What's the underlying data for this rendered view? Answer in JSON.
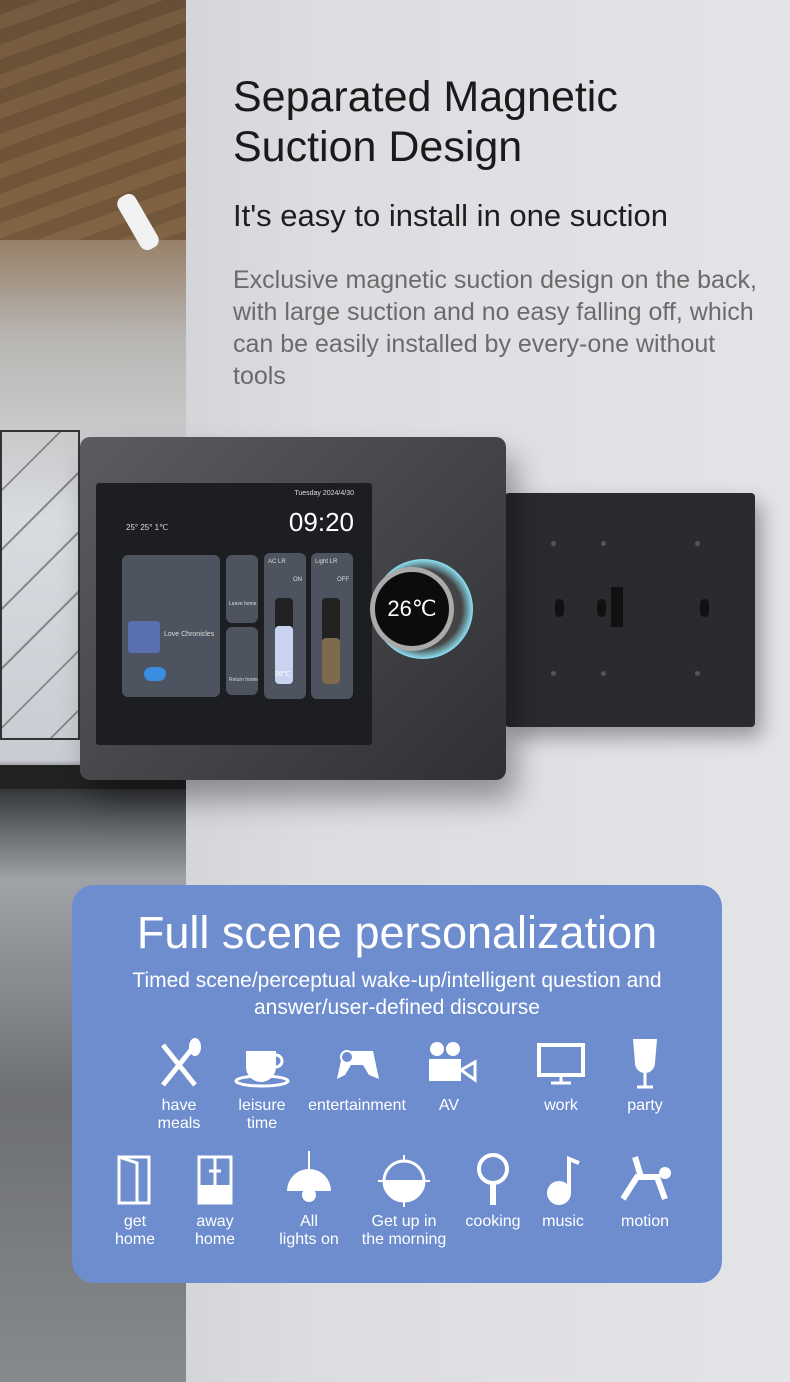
{
  "header": {
    "title_line1": "Separated Magnetic",
    "title_line2": "Suction Design",
    "subtitle": "It's easy to install in one suction",
    "description": "Exclusive magnetic suction design on the back, with large suction and no easy falling off, which can be easily installed by every-one without tools"
  },
  "device": {
    "screen_date": "Tuesday 2024/4/30",
    "screen_time": "09:20",
    "weather": "25°  25°  1℃",
    "music_title": "Love Chronicles",
    "scene_1": "Leave home",
    "scene_2": "Return home",
    "ac_label": "AC LR",
    "ac_state": "ON",
    "ac_temp": "26℃",
    "light_label": "Light LR",
    "light_state": "OFF",
    "knob_temp": "26℃",
    "accent": "#1bb8e0"
  },
  "panel": {
    "title": "Full scene personalization",
    "text": "Timed scene/perceptual wake-up/intelligent question and answer/user-defined discourse",
    "bg": "#6d8dce",
    "scenes": [
      {
        "icon": "fork-spoon-icon",
        "label": "have\nmeals"
      },
      {
        "icon": "coffee-cup-icon",
        "label": "leisure\ntime"
      },
      {
        "icon": "gamepad-icon",
        "label": "entertainment"
      },
      {
        "icon": "video-camera-icon",
        "label": "AV"
      },
      {
        "icon": "monitor-icon",
        "label": "work"
      },
      {
        "icon": "wine-glass-icon",
        "label": "party"
      },
      {
        "icon": "door-icon",
        "label": "get\nhome"
      },
      {
        "icon": "cabinet-icon",
        "label": "away\nhome"
      },
      {
        "icon": "pendant-lamp-icon",
        "label": "All\nlights on"
      },
      {
        "icon": "sunrise-icon",
        "label": "Get up in\nthe morning"
      },
      {
        "icon": "pan-icon",
        "label": "cooking"
      },
      {
        "icon": "music-note-icon",
        "label": "music"
      },
      {
        "icon": "motion-icon",
        "label": "motion"
      }
    ]
  }
}
